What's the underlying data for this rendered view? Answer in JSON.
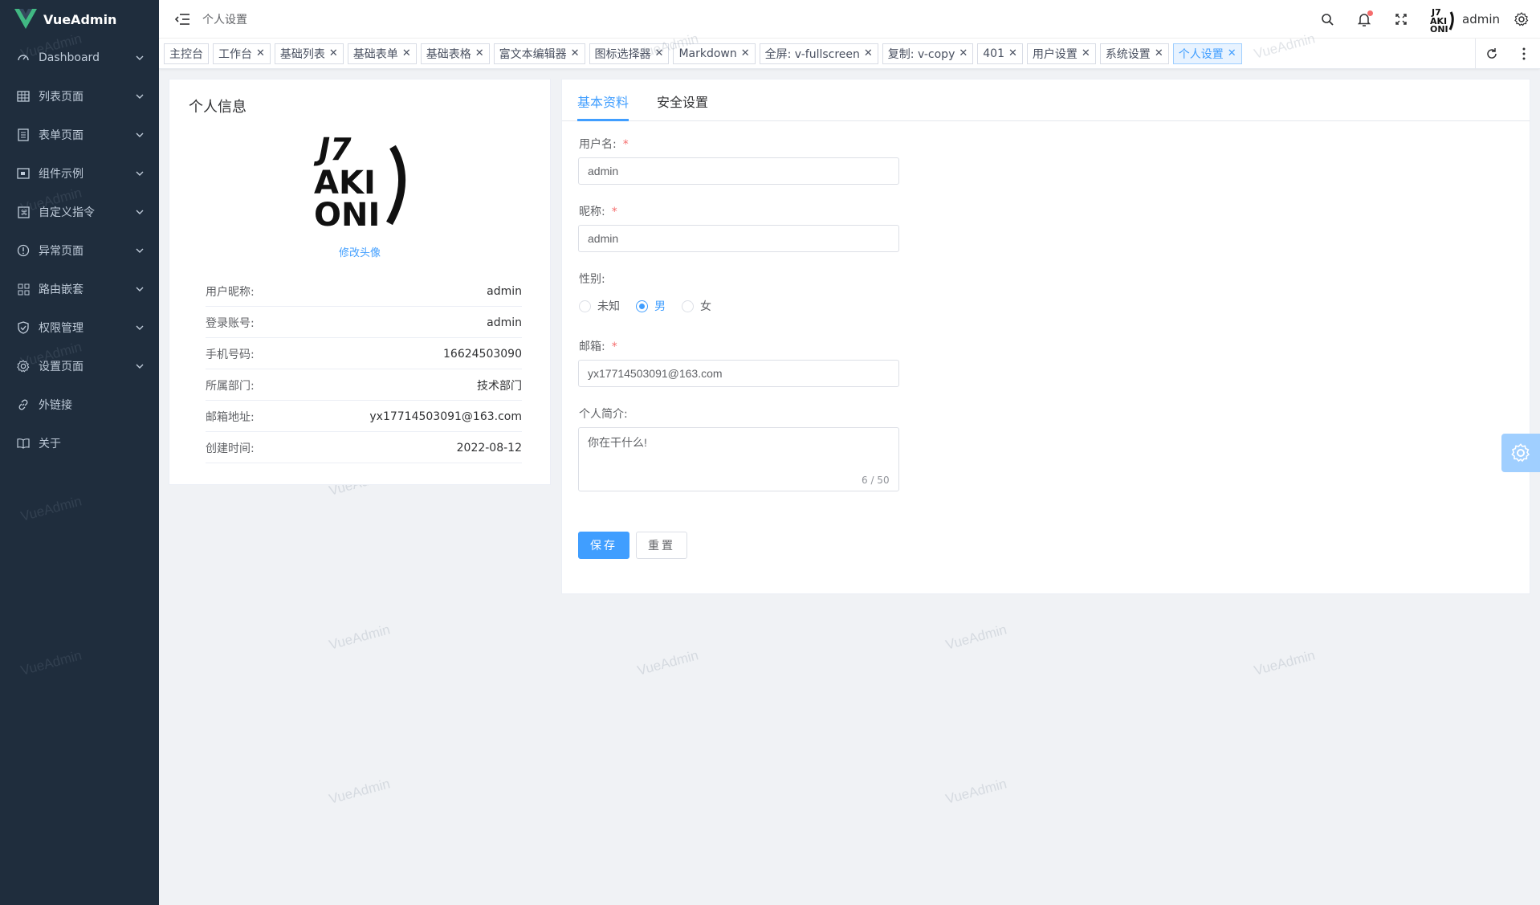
{
  "app": {
    "name": "VueAdmin",
    "brand_color": "#409eff",
    "sidebar_bg": "#1f2d3d"
  },
  "sidebar": {
    "items": [
      {
        "label": "Dashboard",
        "icon": "dashboard-icon",
        "has_children": true
      },
      {
        "label": "列表页面",
        "icon": "grid-icon",
        "has_children": true
      },
      {
        "label": "表单页面",
        "icon": "list-icon",
        "has_children": true
      },
      {
        "label": "组件示例",
        "icon": "component-icon",
        "has_children": true
      },
      {
        "label": "自定义指令",
        "icon": "command-icon",
        "has_children": true
      },
      {
        "label": "异常页面",
        "icon": "warning-icon",
        "has_children": true
      },
      {
        "label": "路由嵌套",
        "icon": "apps-icon",
        "has_children": true
      },
      {
        "label": "权限管理",
        "icon": "shield-icon",
        "has_children": true
      },
      {
        "label": "设置页面",
        "icon": "gear-icon",
        "has_children": true
      },
      {
        "label": "外链接",
        "icon": "link-icon",
        "has_children": false
      },
      {
        "label": "关于",
        "icon": "book-icon",
        "has_children": false
      }
    ]
  },
  "header": {
    "breadcrumb": "个人设置",
    "username": "admin",
    "icons": [
      "search-icon",
      "bell-icon",
      "fullscreen-icon",
      "avatar",
      "gear-icon"
    ]
  },
  "tags": [
    {
      "label": "主控台",
      "closable": false,
      "active": false
    },
    {
      "label": "工作台",
      "closable": true,
      "active": false
    },
    {
      "label": "基础列表",
      "closable": true,
      "active": false
    },
    {
      "label": "基础表单",
      "closable": true,
      "active": false
    },
    {
      "label": "基础表格",
      "closable": true,
      "active": false
    },
    {
      "label": "富文本编辑器",
      "closable": true,
      "active": false
    },
    {
      "label": "图标选择器",
      "closable": true,
      "active": false
    },
    {
      "label": "Markdown",
      "closable": true,
      "active": false
    },
    {
      "label": "全屏: v-fullscreen",
      "closable": true,
      "active": false
    },
    {
      "label": "复制: v-copy",
      "closable": true,
      "active": false
    },
    {
      "label": "401",
      "closable": true,
      "active": false
    },
    {
      "label": "用户设置",
      "closable": true,
      "active": false
    },
    {
      "label": "系统设置",
      "closable": true,
      "active": false
    },
    {
      "label": "个人设置",
      "closable": true,
      "active": true
    }
  ],
  "watermark": "VueAdmin",
  "profile": {
    "title": "个人信息",
    "change_avatar": "修改头像",
    "rows": [
      {
        "key": "用户昵称:",
        "value": "admin"
      },
      {
        "key": "登录账号:",
        "value": "admin"
      },
      {
        "key": "手机号码:",
        "value": "16624503090"
      },
      {
        "key": "所属部门:",
        "value": "技术部门"
      },
      {
        "key": "邮箱地址:",
        "value": "yx17714503091@163.com"
      },
      {
        "key": "创建时间:",
        "value": "2022-08-12"
      }
    ]
  },
  "form": {
    "tabs": [
      "基本资料",
      "安全设置"
    ],
    "username": {
      "label": "用户名:",
      "value": "admin",
      "required": "*"
    },
    "nickname": {
      "label": "昵称:",
      "value": "admin",
      "required": "*"
    },
    "gender": {
      "label": "性别:",
      "options": [
        "未知",
        "男",
        "女"
      ],
      "selected": "男"
    },
    "email": {
      "label": "邮箱:",
      "value": "yx17714503091@163.com",
      "required": "*"
    },
    "bio": {
      "label": "个人简介:",
      "value": "你在干什么!",
      "counter": "6 / 50"
    },
    "save_label": "保存",
    "reset_label": "重置"
  }
}
